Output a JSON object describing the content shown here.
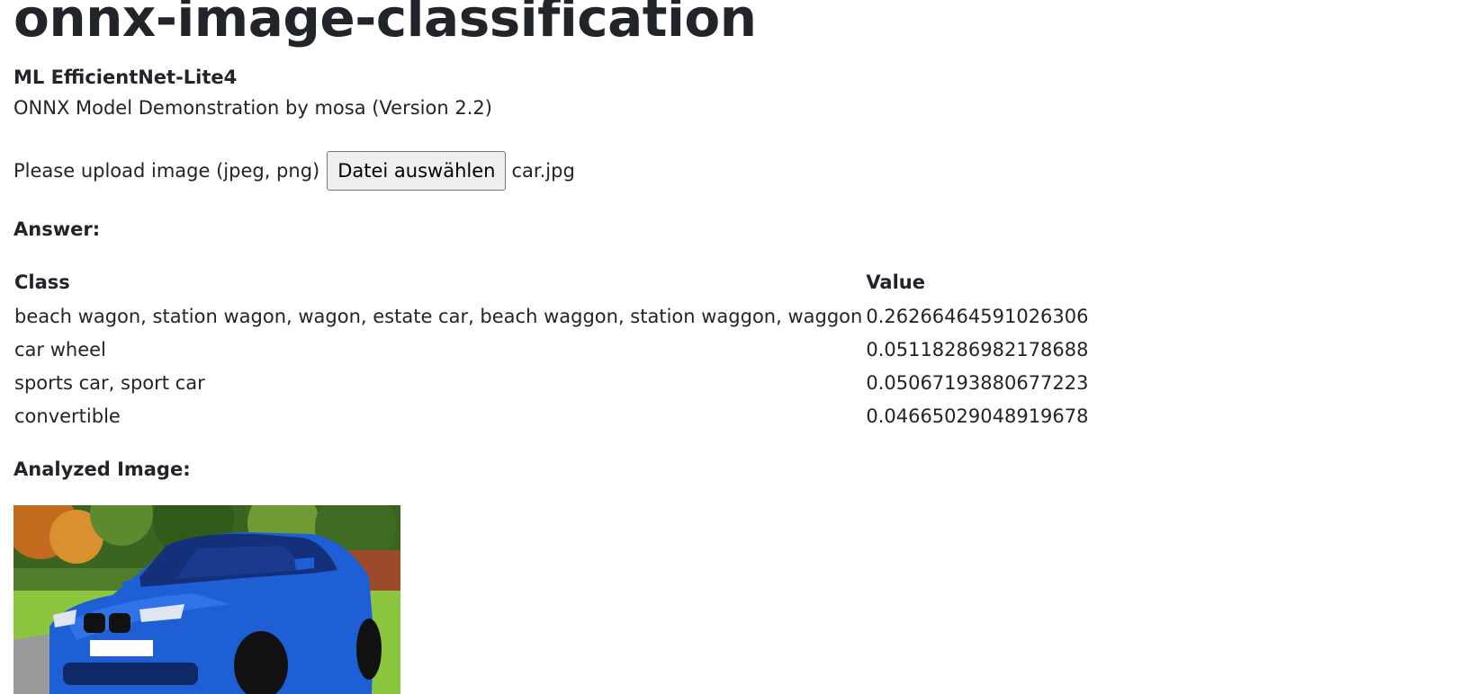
{
  "header": {
    "title": "onnx-image-classification",
    "subtitle": "ML EfficientNet-Lite4",
    "description": "ONNX Model Demonstration by mosa (Version 2.2)"
  },
  "upload": {
    "label": "Please upload image (jpeg, png)",
    "button_label": "Datei auswählen",
    "selected_file": "car.jpg"
  },
  "answer": {
    "label": "Answer:",
    "columns": [
      "Class",
      "Value"
    ],
    "rows": [
      {
        "class": "beach wagon, station wagon, wagon, estate car, beach waggon, station waggon, waggon",
        "value": "0.26266464591026306"
      },
      {
        "class": "car wheel",
        "value": "0.05118286982178688"
      },
      {
        "class": "sports car, sport car",
        "value": "0.05067193880677223"
      },
      {
        "class": "convertible",
        "value": "0.04665029048919678"
      }
    ]
  },
  "analyzed": {
    "label": "Analyzed Image:"
  },
  "colors": {
    "text": "#212529",
    "car_body": "#1f5fd6"
  }
}
